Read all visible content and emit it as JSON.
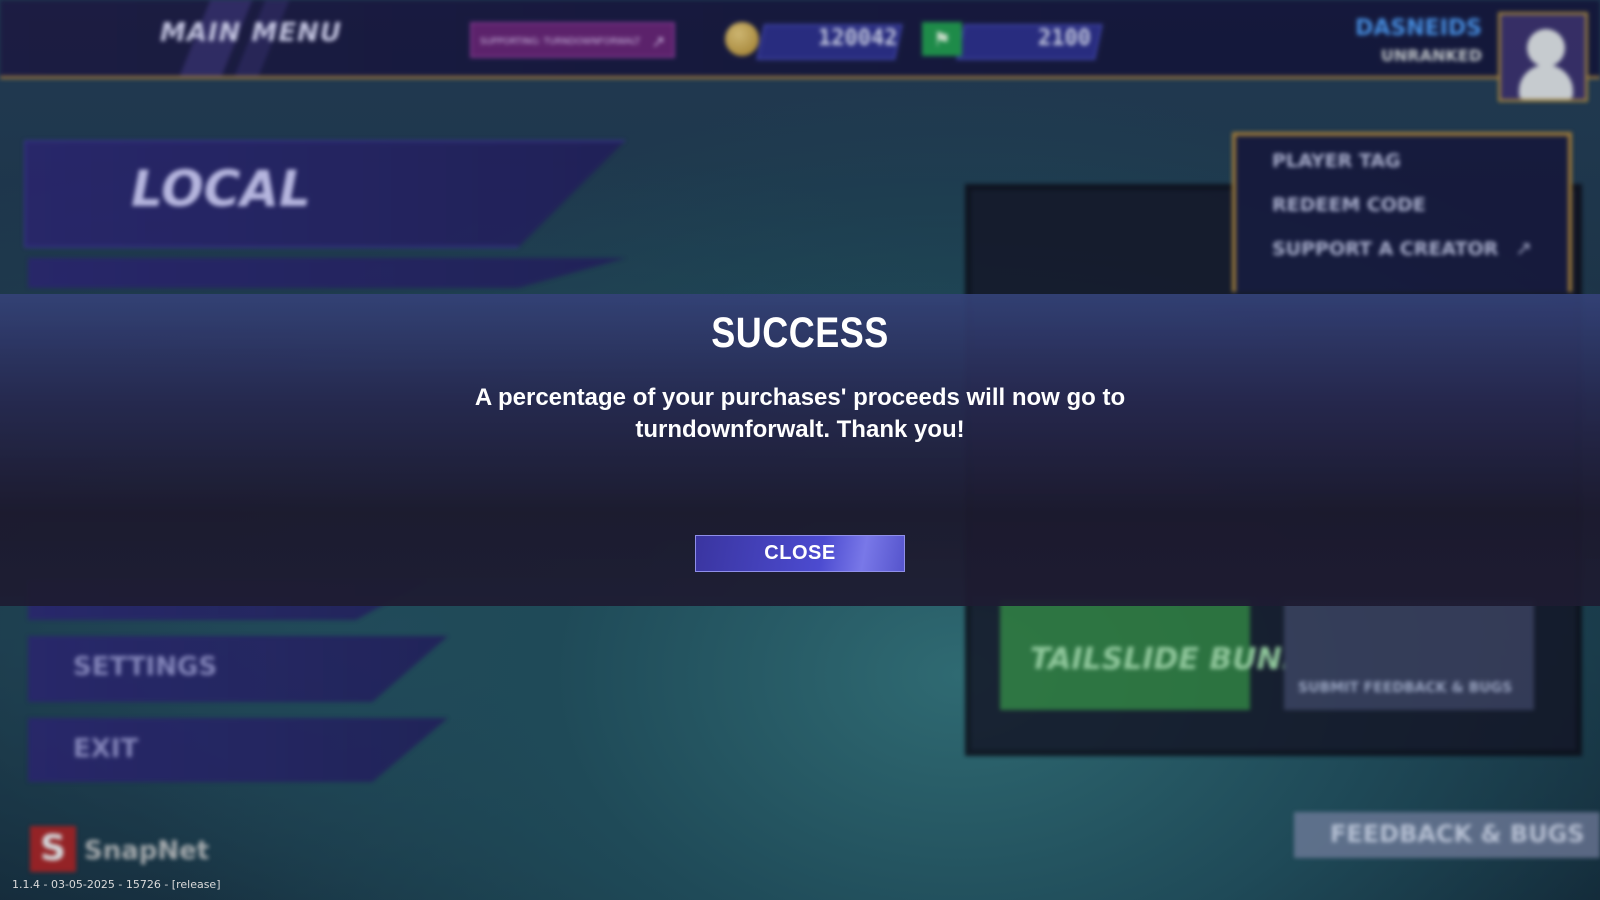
{
  "topbar": {
    "title": "MAIN MENU",
    "creator_label": "SUPPORTING: TURNDOWNFORWALT",
    "coins": "120042",
    "gems": "2100",
    "username": "DASNEIDS",
    "rank": "UNRANKED"
  },
  "menu": {
    "local": "LOCAL",
    "settings": "SETTINGS",
    "exit": "EXIT"
  },
  "dropdown": {
    "items": [
      "PLAYER TAG",
      "REDEEM CODE",
      "SUPPORT A CREATOR"
    ]
  },
  "store": {
    "bundle_label": "TAILSLIDE BUNDLE",
    "discord_label": "SUBMIT FEEDBACK & BUGS"
  },
  "footer": {
    "feedback": "FEEDBACK & BUGS",
    "brand": "SnapNet",
    "version": "1.1.4 - 03-05-2025 - 15726 - [release]"
  },
  "modal": {
    "title": "SUCCESS",
    "message": "A percentage of your purchases' proceeds will now go to turndownforwalt. Thank you!",
    "close_label": "CLOSE"
  }
}
